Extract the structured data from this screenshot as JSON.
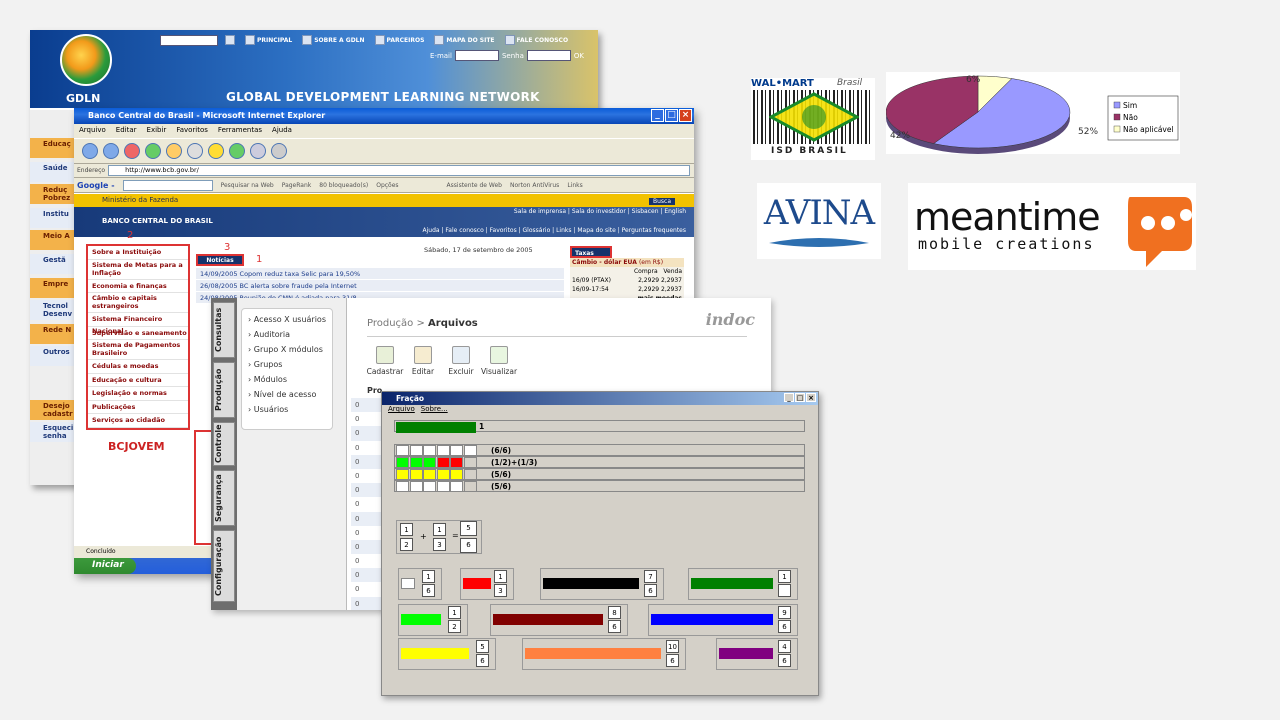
{
  "gdln": {
    "toolbar": [
      "PRINCIPAL",
      "SOBRE A GDLN",
      "PARCEIROS",
      "MAPA DO SITE",
      "FALE CONOSCO"
    ],
    "email_label": "E-mail",
    "senha_label": "Senha",
    "ok_label": "OK",
    "logo_text": "GDLN",
    "network_title": "GLOBAL DEVELOPMENT LEARNING NETWORK",
    "side_items": [
      "Educaç",
      "Saúde",
      "Reduç Pobrez",
      "Institu",
      "Meio A",
      "Gestã",
      "Empre",
      "Tecnol Desenv",
      "Rede N",
      "Outros",
      "Desejo cadastr",
      "Esqueci senha"
    ]
  },
  "ie": {
    "title": "Banco Central do Brasil - Microsoft Internet Explorer",
    "menu": [
      "Arquivo",
      "Editar",
      "Exibir",
      "Favoritos",
      "Ferramentas",
      "Ajuda"
    ],
    "address_label": "Endereço",
    "address": "http://www.bcb.gov.br/",
    "google": "Google -",
    "google_search": "Pesquisar na Web",
    "pagerank": "PageRank",
    "blocked": "80 bloqueado(s)",
    "options": "Opções",
    "assistant": "Assistente de Web",
    "norton": "Norton AntiVirus",
    "links": "Links",
    "ministerio": "Ministério da Fazenda",
    "banco": "BANCO CENTRAL DO BRASIL",
    "top_links": "Sala de imprensa | Sala do investidor | Sisbacen | English",
    "bottom_links": "Ajuda | Fale conosco | Favoritos | Glossário | Links | Mapa do site | Perguntas frequentes",
    "left_nav": [
      "Sobre a Instituição",
      "Sistema de Metas para a Inflação",
      "Economia e finanças",
      "Câmbio e capitais estrangeiros",
      "Sistema Financeiro Nacional",
      "Supervisão e saneamento",
      "Sistema de Pagamentos Brasileiro",
      "Cédulas e moedas",
      "Educação e cultura",
      "Legislação e normas",
      "Publicações",
      "Serviços ao cidadão"
    ],
    "date": "Sábado, 17 de setembro de 2005",
    "noticias": "Notícias",
    "news": [
      "14/09/2005  Copom reduz taxa Selic para 19,50%",
      "26/08/2005  BC alerta sobre fraude pela Internet",
      "24/08/2005  Reunião do CMN é adiada para 31/8"
    ],
    "taxas": "Taxas",
    "cambio": "Câmbio - dólar EUA",
    "cambio_unit": "(em R$)",
    "compra": "Compra",
    "venda": "Venda",
    "rate_rows": [
      [
        "16/09 (PTAX)",
        "2,2929",
        "2,2937"
      ],
      [
        "16/09-17:54",
        "2,2929",
        "2,2937"
      ]
    ],
    "mais_moedas": "mais moedas",
    "busca": "Busca",
    "status": "Concluído",
    "start": "Iniciar",
    "bcj": "BCJOVEM",
    "annotations": [
      "1",
      "2",
      "3"
    ]
  },
  "indoc": {
    "tabs": [
      "Consultas",
      "Produção",
      "Controle",
      "Segurança",
      "Configuração"
    ],
    "menu": [
      "Acesso X usuários",
      "Auditoria",
      "Grupo X módulos",
      "Grupos",
      "Módulos",
      "Nível de acesso",
      "Usuários"
    ],
    "crumb_prefix": "Produção >",
    "crumb_current": "Arquivos",
    "brand": "indoc",
    "actions": [
      "Cadastrar",
      "Editar",
      "Excluir",
      "Visualizar"
    ],
    "col_header": "Pro",
    "row_prefix": "0"
  },
  "fracao": {
    "title": "Fração",
    "menu": [
      "Arquivo",
      "Sobre..."
    ],
    "bar_labels": [
      "1",
      "(6/6)",
      "(1/2)+(1/3)",
      "(5/6)",
      "(5/6)"
    ],
    "sum": {
      "a_num": "1",
      "a_den": "2",
      "op": "+",
      "b_num": "1",
      "b_den": "3",
      "eq": "=",
      "r_num": "5",
      "r_den": "6"
    },
    "pieces": [
      {
        "num": "1",
        "den": "6",
        "color": "#ffffff"
      },
      {
        "num": "1",
        "den": "3",
        "color": "#ff0000"
      },
      {
        "num": "7",
        "den": "6",
        "color": "#000000"
      },
      {
        "num": "1",
        "den": "",
        "color": "#008000"
      },
      {
        "num": "1",
        "den": "2",
        "color": "#00ff00"
      },
      {
        "num": "8",
        "den": "6",
        "color": "#800000"
      },
      {
        "num": "9",
        "den": "6",
        "color": "#0000ff"
      },
      {
        "num": "5",
        "den": "6",
        "color": "#ffff00"
      },
      {
        "num": "10",
        "den": "6",
        "color": "#ff8040"
      },
      {
        "num": "4",
        "den": "6",
        "color": "#800080"
      }
    ]
  },
  "logos": {
    "walmart": "WAL•MART",
    "walmart_script": "Brasil",
    "isd": "ISD BRASIL",
    "avina": "AVINA",
    "meantime": "meantime",
    "meantime_sub": "mobile creations"
  },
  "chart_data": {
    "type": "pie",
    "categories": [
      "Sim",
      "Não",
      "Não aplicável"
    ],
    "values": [
      52,
      42,
      6
    ],
    "labels": [
      "52%",
      "42%",
      "6%"
    ],
    "colors": [
      "#9999ff",
      "#993366",
      "#ffffcc"
    ],
    "legend": "right"
  }
}
